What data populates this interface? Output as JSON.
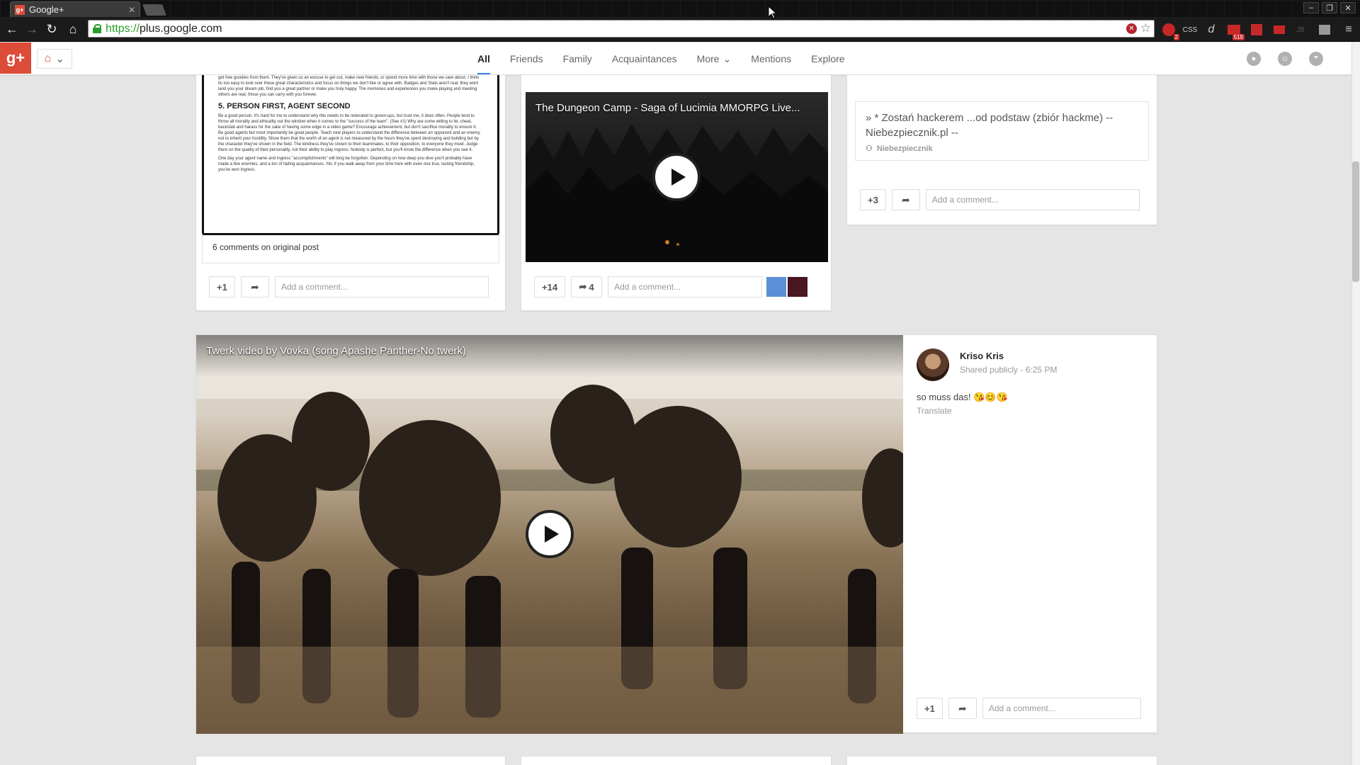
{
  "browser": {
    "tab_title": "Google+",
    "tab_favicon": "g+",
    "url_scheme": "https://",
    "url_host": "plus.google.com",
    "extension_badge_1": "2",
    "extension_badge_2": "519",
    "extension_css_label": "CSS"
  },
  "gplus": {
    "logo": "g+",
    "nav": [
      "All",
      "Friends",
      "Family",
      "Acquaintances",
      "More",
      "Mentions",
      "Explore"
    ],
    "more_chevron": "⌄"
  },
  "card1": {
    "doc_lines_top": "get free goodies from them. They've given us an excuse to get out, make new friends, or spend more time with those we care about. I think its too easy to look over these great characteristics and focus on things we don't like or agree with. Badges and Stats aren't real; they wont land you your dream job, find you a great partner or make you truly happy. The memories and experiences you make playing and meeting others are real, those you can carry with you forever.",
    "doc_heading": "5. PERSON FIRST, AGENT SECOND",
    "doc_para_2": "Be a good person. It's hard for me to understand why this needs to be reiterated to grown-ups, but trust me, it does often. People tend to throw all morality and ethicality out the window when it comes to the \"success of the team\". (See #1) Why are some willing to lie, cheat, backstab and harass for the sake of having some edge in a video game? Encourage achievement, but don't sacrifice morality to ensure it. Be good agents but most importantly be great people. Teach new players to understand the difference between an opponent and an enemy, not to inherit your hostility. Show them that the worth of an agent is not measured by the hours they've spent destroying and building but by the character they've shown in the field. The kindness they've shown to their teammates, to their opposition, to everyone they meet. Judge them on the quality of their personality, not their ability to play Ingress. Nobody is perfect, but you'll know the difference when you see it.",
    "doc_para_3": "One day your agent name and Ingress \"accomplishments\" will long be forgotten. Depending on how deep you dive you'll probably have made a few enemies, and a ton of fading acquaintances. Yet, if you walk away from your time here with even one true, lasting friendship, you've won Ingress.",
    "comments_line": "6 comments on original post",
    "plus_label": "+1",
    "comment_placeholder": "Add a comment..."
  },
  "card2": {
    "video_title": "The Dungeon Camp - Saga of Lucimia MMORPG Live...",
    "plus_label": "+14",
    "share_count": "4",
    "comment_placeholder": "Add a comment..."
  },
  "card3": {
    "link_title": "» * Zostań hackerem ...od podstaw (zbiór hackme) -- Niebezpiecznik.pl --",
    "link_source": "Niebezpiecznik",
    "plus_label": "+3",
    "comment_placeholder": "Add a comment..."
  },
  "card4": {
    "video_title": "Twerk video by Vovka (song Apashe Panther-No twerk)",
    "author_name": "Kriso Kris",
    "shared": "Shared publicly",
    "time": "6:25 PM",
    "text": "so muss das! 😘😊😘",
    "translate": "Translate",
    "plus_label": "+1",
    "comment_placeholder": "Add a comment..."
  },
  "colors": {
    "brand_red": "#dd4b39",
    "active_tab_underline": "#427fed",
    "secure_green": "#2a9d2a"
  }
}
